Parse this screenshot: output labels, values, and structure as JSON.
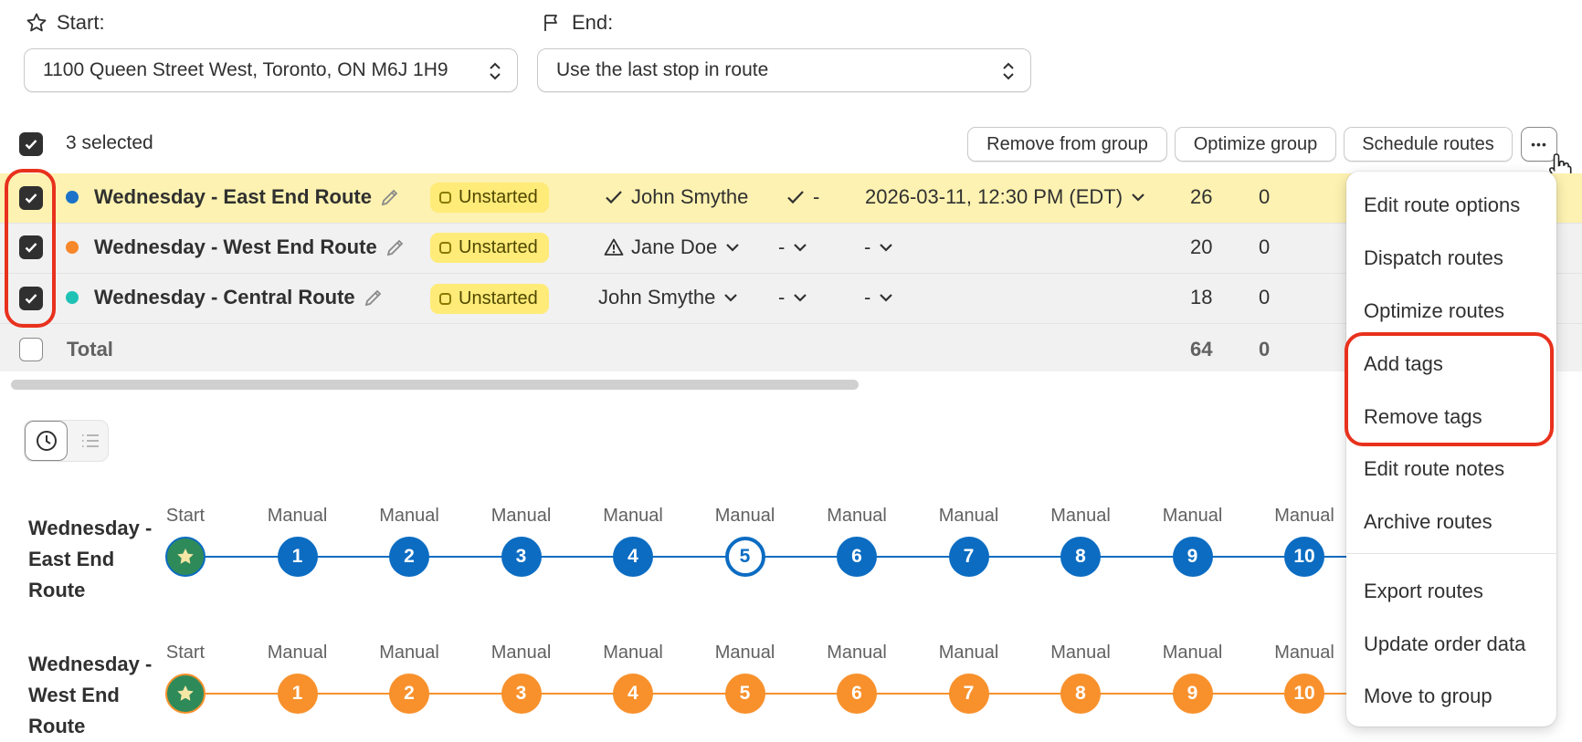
{
  "route_settings": {
    "start_label": "Start:",
    "start_value": "1100 Queen Street West, Toronto, ON M6J 1H9",
    "end_label": "End:",
    "end_value": "Use the last stop in route"
  },
  "bulk_bar": {
    "selected_text": "3 selected",
    "remove_from_group": "Remove from group",
    "optimize_group": "Optimize group",
    "schedule_routes": "Schedule routes",
    "more_label": "•••"
  },
  "routes": [
    {
      "name": "Wednesday - East End Route",
      "color": "#1a73c9",
      "status": "Unstarted",
      "driver": "John Smythe",
      "vehicle": "-",
      "start_time": "2026-03-11, 12:30 PM (EDT)",
      "stops": "26",
      "extra": "0"
    },
    {
      "name": "Wednesday - West End Route",
      "color": "#f7872b",
      "status": "Unstarted",
      "driver": "Jane Doe",
      "vehicle": "-",
      "start_time": "-",
      "stops": "20",
      "extra": "0"
    },
    {
      "name": "Wednesday - Central Route",
      "color": "#1ec2b5",
      "status": "Unstarted",
      "driver": "John Smythe",
      "vehicle": "-",
      "start_time": "-",
      "stops": "18",
      "extra": "0"
    }
  ],
  "totals": {
    "label": "Total",
    "stops": "64",
    "extra": "0"
  },
  "menu": {
    "items": [
      "Edit route options",
      "Dispatch routes",
      "Optimize routes",
      "Add tags",
      "Remove tags",
      "Edit route notes",
      "Archive routes",
      "Export routes",
      "Update order data",
      "Move to group"
    ]
  },
  "timeline": {
    "start_label": "Start",
    "stop_label": "Manual",
    "routes": [
      {
        "name": "Wednesday - East End Route",
        "color": "#0b6cc2",
        "stops": [
          "1",
          "2",
          "3",
          "4",
          "5",
          "6",
          "7",
          "8",
          "9",
          "10"
        ],
        "highlighted_stop": "5"
      },
      {
        "name": "Wednesday - West End Route",
        "color": "#f8912c",
        "stops": [
          "1",
          "2",
          "3",
          "4",
          "5",
          "6",
          "7",
          "8",
          "9",
          "10"
        ]
      }
    ]
  }
}
